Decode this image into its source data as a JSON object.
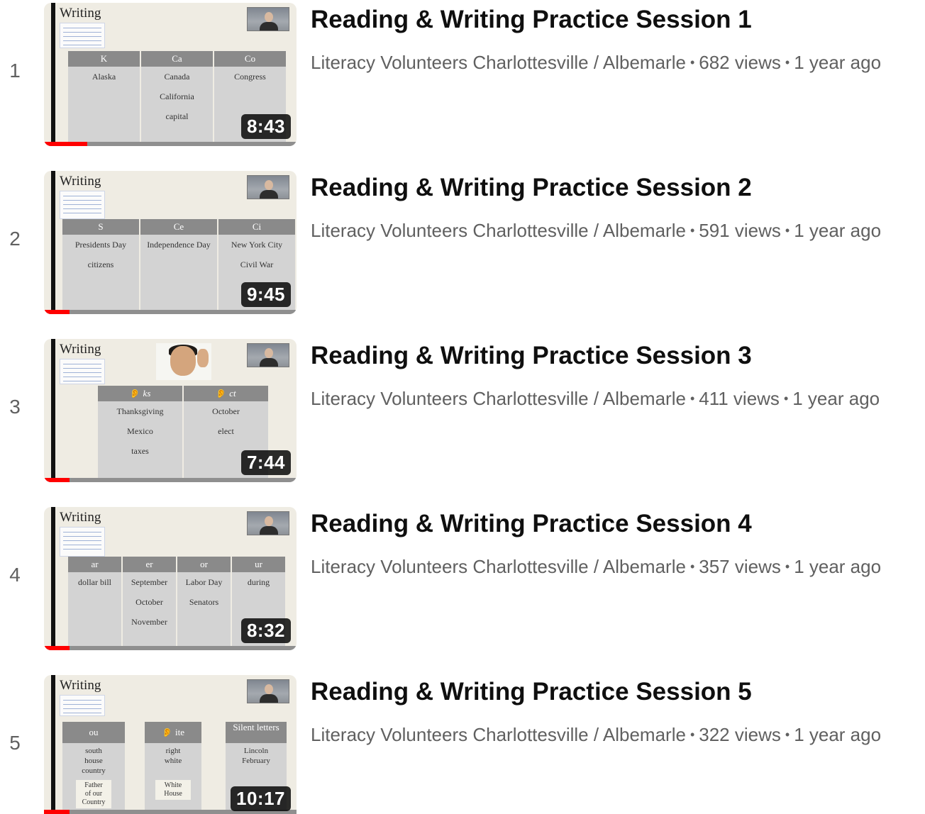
{
  "videos": [
    {
      "index": "1",
      "title": "Reading & Writing Practice Session 1",
      "channel": "Literacy Volunteers Charlottesville / Albemarle",
      "views": "682 views",
      "age": "1 year ago",
      "duration": "8:43",
      "watched_fraction": 0.17,
      "slide": {
        "heading": "Writing",
        "columns": [
          {
            "head": "K",
            "cells": [
              "Alaska"
            ]
          },
          {
            "head": "Ca",
            "cells": [
              "Canada",
              "California",
              "capital"
            ]
          },
          {
            "head": "Co",
            "cells": [
              "Congress"
            ]
          }
        ]
      }
    },
    {
      "index": "2",
      "title": "Reading & Writing Practice Session 2",
      "channel": "Literacy Volunteers Charlottesville / Albemarle",
      "views": "591 views",
      "age": "1 year ago",
      "duration": "9:45",
      "watched_fraction": 0.1,
      "slide": {
        "heading": "Writing",
        "columns": [
          {
            "head": "S",
            "cells": [
              "Presidents Day",
              "",
              "citizens"
            ]
          },
          {
            "head": "Ce",
            "cells": [
              "Independence Day"
            ]
          },
          {
            "head": "Ci",
            "cells": [
              "New York City",
              "Civil War"
            ]
          }
        ]
      }
    },
    {
      "index": "3",
      "title": "Reading & Writing Practice Session 3",
      "channel": "Literacy Volunteers Charlottesville / Albemarle",
      "views": "411 views",
      "age": "1 year ago",
      "duration": "7:44",
      "watched_fraction": 0.1,
      "slide": {
        "heading": "Writing",
        "columns": [
          {
            "head": "ks",
            "cells": [
              "Thanksgiving",
              "Mexico",
              "taxes"
            ]
          },
          {
            "head": "ct",
            "cells": [
              "October",
              "elect"
            ]
          }
        ]
      }
    },
    {
      "index": "4",
      "title": "Reading & Writing Practice Session 4",
      "channel": "Literacy Volunteers Charlottesville / Albemarle",
      "views": "357 views",
      "age": "1 year ago",
      "duration": "8:32",
      "watched_fraction": 0.1,
      "slide": {
        "heading": "Writing",
        "columns": [
          {
            "head": "ar",
            "cells": [
              "dollar bill"
            ]
          },
          {
            "head": "er",
            "cells": [
              "September",
              "October",
              "November"
            ]
          },
          {
            "head": "or",
            "cells": [
              "Labor Day",
              "Senators"
            ]
          },
          {
            "head": "ur",
            "cells": [
              "during"
            ]
          }
        ]
      }
    },
    {
      "index": "5",
      "title": "Reading & Writing Practice Session 5",
      "channel": "Literacy Volunteers Charlottesville / Albemarle",
      "views": "322 views",
      "age": "1 year ago",
      "duration": "10:17",
      "watched_fraction": 0.1,
      "slide": {
        "heading": "Writing",
        "columns": [
          {
            "head": "ou",
            "cells": [
              "south",
              "house",
              "country"
            ],
            "box": [
              "Father",
              "of our",
              "Country"
            ]
          },
          {
            "head": "ite",
            "cells": [
              "right",
              "white"
            ],
            "box": [
              "White",
              "House"
            ]
          },
          {
            "head": "Silent letters",
            "cells": [
              "Lincoln",
              "February"
            ]
          }
        ]
      }
    }
  ]
}
